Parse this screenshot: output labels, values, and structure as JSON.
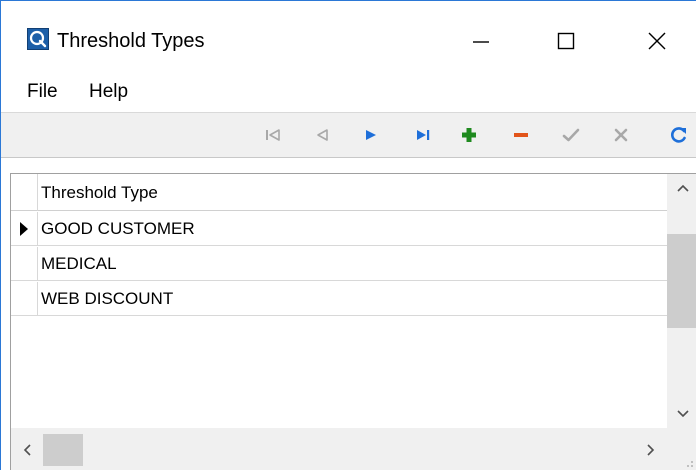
{
  "window": {
    "title": "Threshold Types",
    "controls": {
      "minimize": "minimize-icon",
      "maximize": "maximize-icon",
      "close": "close-icon"
    }
  },
  "menu": {
    "file_label": "File",
    "help_label": "Help"
  },
  "toolbar": {
    "buttons": [
      {
        "name": "first-record",
        "icon": "first-record-icon",
        "enabled": false
      },
      {
        "name": "previous-record",
        "icon": "previous-record-icon",
        "enabled": false
      },
      {
        "name": "next-record",
        "icon": "next-record-icon",
        "enabled": true
      },
      {
        "name": "last-record",
        "icon": "last-record-icon",
        "enabled": true
      },
      {
        "name": "add-record",
        "icon": "plus-icon",
        "enabled": true
      },
      {
        "name": "delete-record",
        "icon": "minus-icon",
        "enabled": true
      },
      {
        "name": "post-edit",
        "icon": "checkmark-icon",
        "enabled": false
      },
      {
        "name": "cancel-edit",
        "icon": "x-icon",
        "enabled": false
      },
      {
        "name": "refresh",
        "icon": "refresh-icon",
        "enabled": true
      }
    ],
    "colors": {
      "disabled": "#a8a8a8",
      "nav": "#1e6fd9",
      "add": "#1f8a1f",
      "delete": "#e2541a",
      "refresh": "#1e6fd9"
    }
  },
  "grid": {
    "columns": [
      "Threshold Type"
    ],
    "rows": [
      {
        "threshold_type": "GOOD CUSTOMER",
        "current": true
      },
      {
        "threshold_type": "MEDICAL",
        "current": false
      },
      {
        "threshold_type": "WEB DISCOUNT",
        "current": false
      }
    ]
  }
}
